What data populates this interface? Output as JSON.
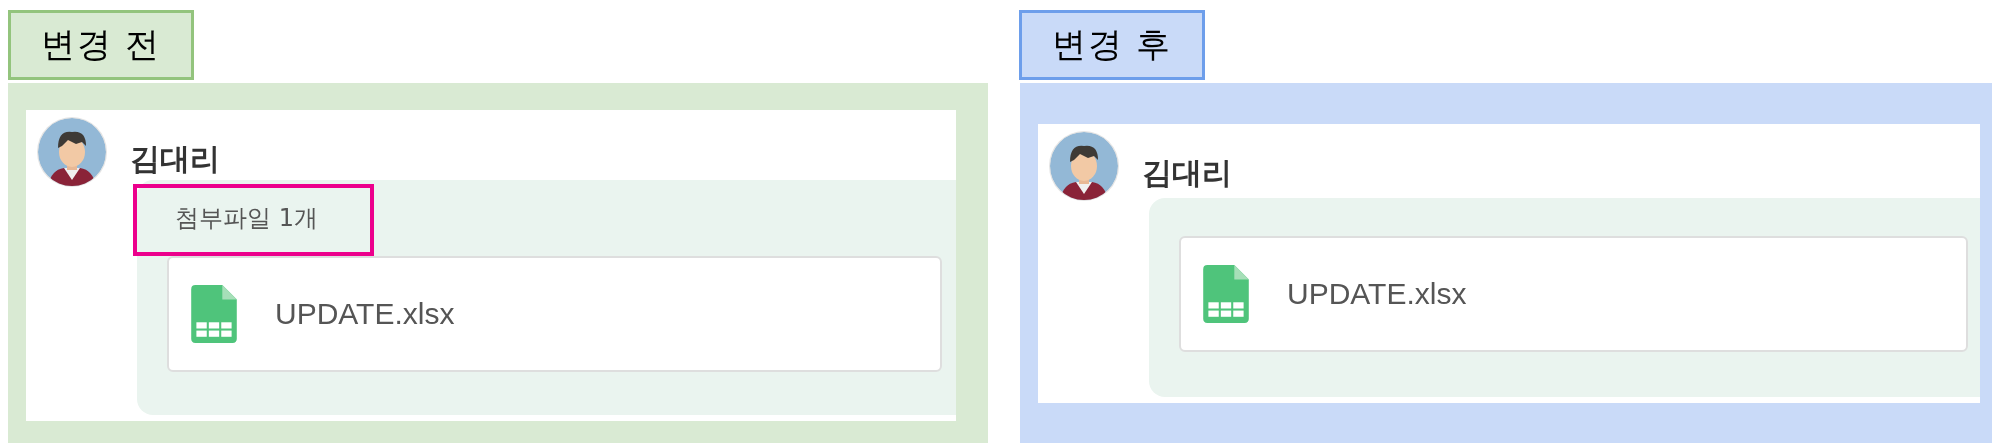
{
  "panels": [
    {
      "kind": "before",
      "label": "변경 전",
      "color": "#d9ead3",
      "user": {
        "name": "김대리"
      },
      "attachment_header": {
        "text": "첨부파일 1개",
        "highlighted": true
      },
      "files": [
        {
          "name": "UPDATE.xlsx"
        }
      ]
    },
    {
      "kind": "after",
      "label": "변경 후",
      "color": "#c9daf8",
      "user": {
        "name": "김대리"
      },
      "files": [
        {
          "name": "UPDATE.xlsx"
        }
      ]
    }
  ]
}
